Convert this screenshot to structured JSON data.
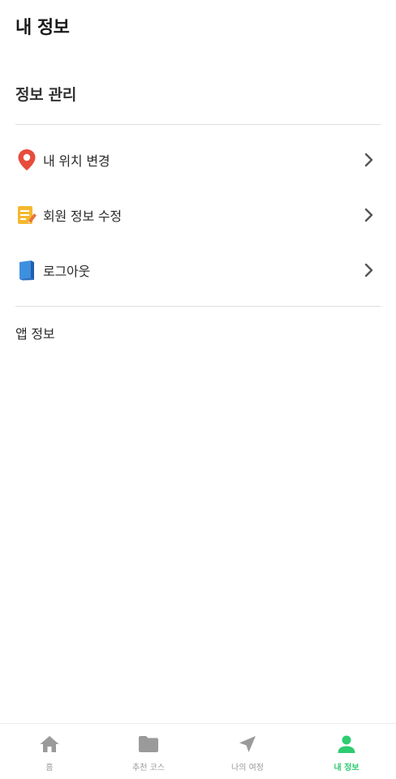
{
  "header": {
    "title": "내 정보"
  },
  "section": {
    "title": "정보 관리",
    "items": [
      {
        "label": "내 위치 변경",
        "icon": "location-pin-icon"
      },
      {
        "label": "회원 정보 수정",
        "icon": "memo-edit-icon"
      },
      {
        "label": "로그아웃",
        "icon": "book-icon"
      }
    ]
  },
  "app_info": {
    "label": "앱 정보"
  },
  "bottom_nav": {
    "items": [
      {
        "label": "홈",
        "icon": "home-icon",
        "active": false
      },
      {
        "label": "추천 코스",
        "icon": "folder-icon",
        "active": false
      },
      {
        "label": "나의 여정",
        "icon": "navigation-arrow-icon",
        "active": false
      },
      {
        "label": "내 정보",
        "icon": "person-icon",
        "active": true
      }
    ]
  },
  "colors": {
    "accent": "#2ecc71",
    "inactive": "#9a9a9a",
    "pin": "#e74c3c",
    "memo": "#f5b82e",
    "book": "#3d8fe0"
  }
}
